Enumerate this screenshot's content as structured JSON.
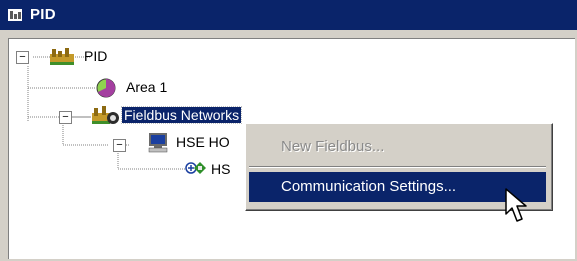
{
  "window": {
    "title": "PID",
    "icon": "pid-window-icon"
  },
  "tree": {
    "root": {
      "label": "PID",
      "expander": "⊟",
      "icon": "plant-area-icon"
    },
    "area": {
      "label": "Area 1",
      "icon": "area-pie-icon"
    },
    "fieldbus": {
      "label": "Fieldbus Networks",
      "expander": "⊟",
      "icon": "fieldbus-networks-icon",
      "selected": true
    },
    "hse_host": {
      "label": "HSE HO",
      "expander": "⊟",
      "icon": "computer-icon"
    },
    "hse_child": {
      "label": "HS",
      "icon": "network-device-icon"
    }
  },
  "context_menu": {
    "items": [
      {
        "label": "New Fieldbus...",
        "enabled": false
      },
      {
        "label": "Communication Settings...",
        "enabled": true,
        "highlighted": true
      }
    ]
  },
  "colors": {
    "selection": "#0a246a",
    "title_bar": "#0a246a",
    "menu_bg": "#d4d0c8"
  }
}
